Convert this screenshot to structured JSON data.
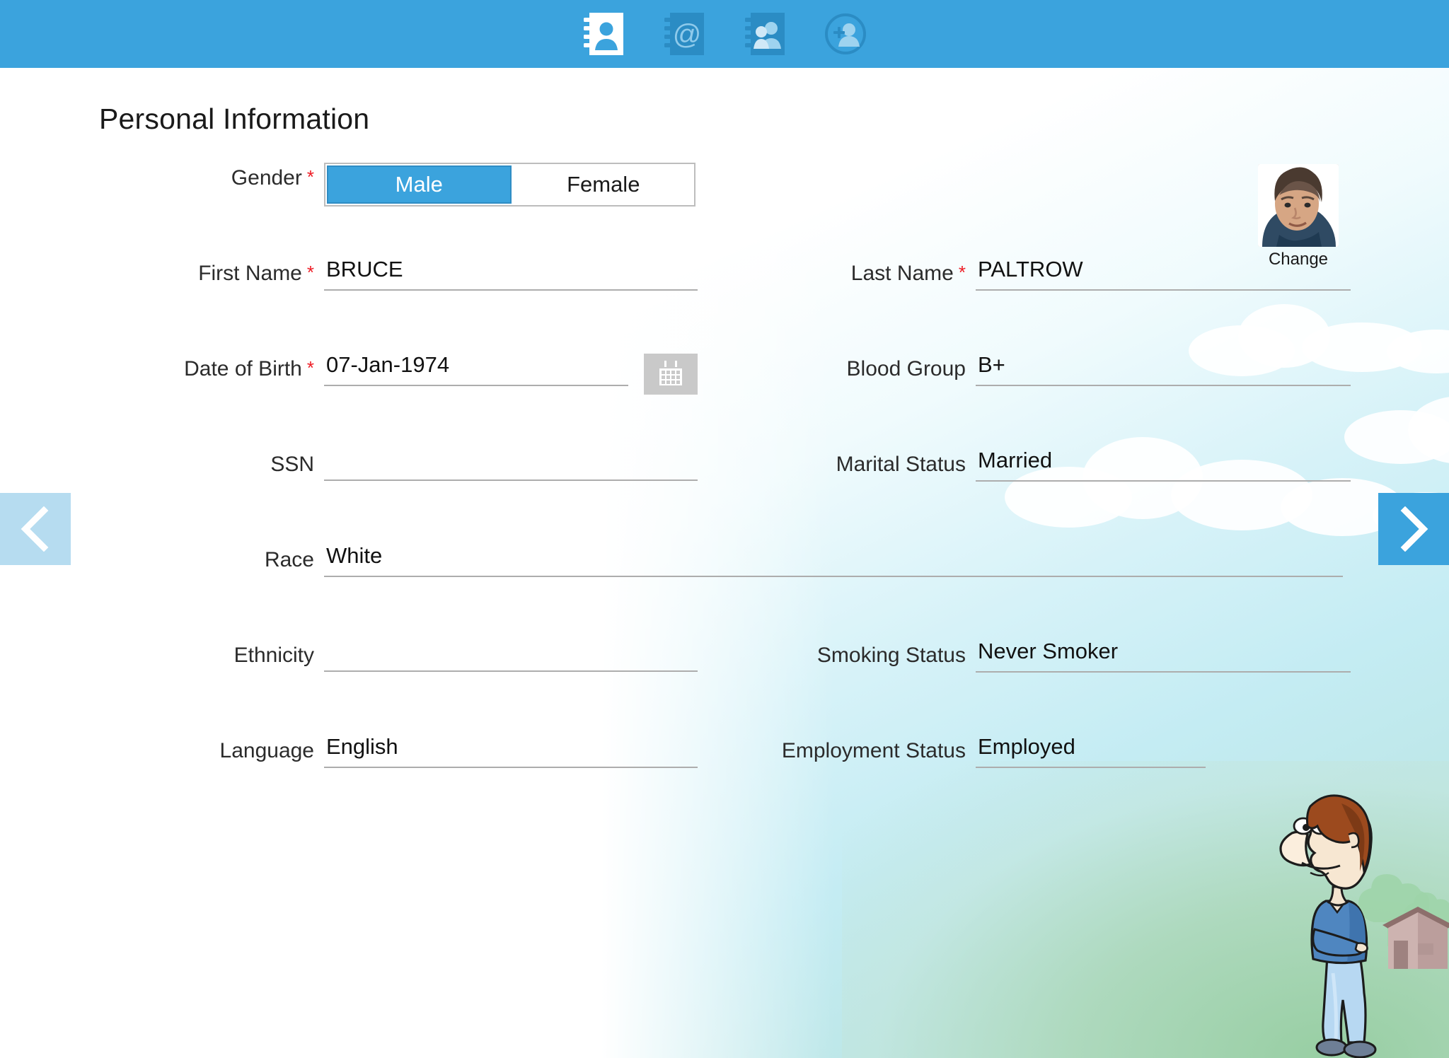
{
  "toolbar": {
    "items": [
      {
        "name": "contact-book-icon",
        "label": "Personal Information",
        "active": true
      },
      {
        "name": "email-book-icon",
        "label": "Contact Information",
        "active": false
      },
      {
        "name": "family-book-icon",
        "label": "Family Information",
        "active": false
      },
      {
        "name": "add-person-icon",
        "label": "Add Person",
        "active": false
      }
    ]
  },
  "page": {
    "title": "Personal Information"
  },
  "avatar": {
    "change_label": "Change",
    "alt": "patient-photo"
  },
  "nav": {
    "prev_label": "‹",
    "next_label": "›"
  },
  "form": {
    "gender": {
      "label": "Gender",
      "required": "*",
      "options": [
        "Male",
        "Female"
      ],
      "selected": "Male"
    },
    "first_name": {
      "label": "First Name",
      "required": "*",
      "value": "BRUCE",
      "placeholder": ""
    },
    "last_name": {
      "label": "Last Name",
      "required": "*",
      "value": "PALTROW",
      "placeholder": ""
    },
    "date_of_birth": {
      "label": "Date of Birth",
      "required": "*",
      "value": "07-Jan-1974",
      "placeholder": ""
    },
    "blood_group": {
      "label": "Blood Group",
      "value": "B+",
      "placeholder": ""
    },
    "ssn": {
      "label": "SSN",
      "value": "",
      "placeholder": ""
    },
    "marital_status": {
      "label": "Marital Status",
      "value": "Married",
      "placeholder": ""
    },
    "race": {
      "label": "Race",
      "value": "White",
      "placeholder": ""
    },
    "ethnicity": {
      "label": "Ethnicity",
      "value": "",
      "placeholder": ""
    },
    "smoking_status": {
      "label": "Smoking Status",
      "value": "Never Smoker",
      "placeholder": ""
    },
    "language": {
      "label": "Language",
      "value": "English",
      "placeholder": ""
    },
    "employment_status": {
      "label": "Employment Status",
      "value": "Employed",
      "placeholder": ""
    }
  },
  "colors": {
    "accent": "#3ba3dd",
    "toolbar_bg": "#3ba3dd",
    "required_star": "#ee1c25",
    "field_underline": "#adadad",
    "nav_prev_bg": "#b6dcf0",
    "nav_next_bg": "#3ba3dd"
  }
}
